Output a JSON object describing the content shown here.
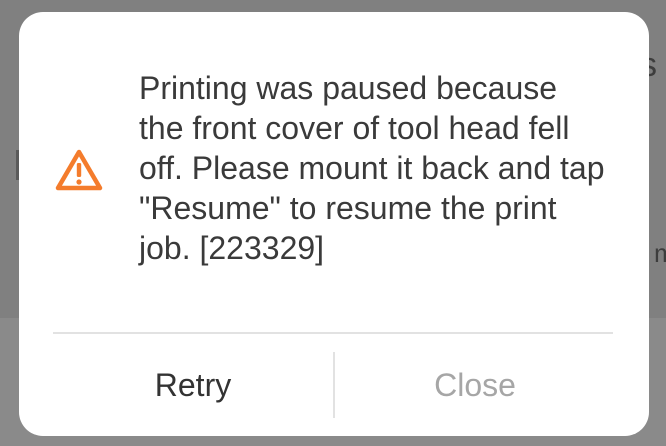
{
  "dialog": {
    "message": "Printing was paused because the front cover of tool head fell off. Please mount it back and tap \"Resume\" to resume the print job. [223329]",
    "icon": "warning-triangle-icon",
    "icon_color": "#f47c2c",
    "buttons": {
      "retry_label": "Retry",
      "close_label": "Close"
    }
  },
  "background": {
    "partial_glyph_1": "s",
    "partial_glyph_2": "m"
  }
}
